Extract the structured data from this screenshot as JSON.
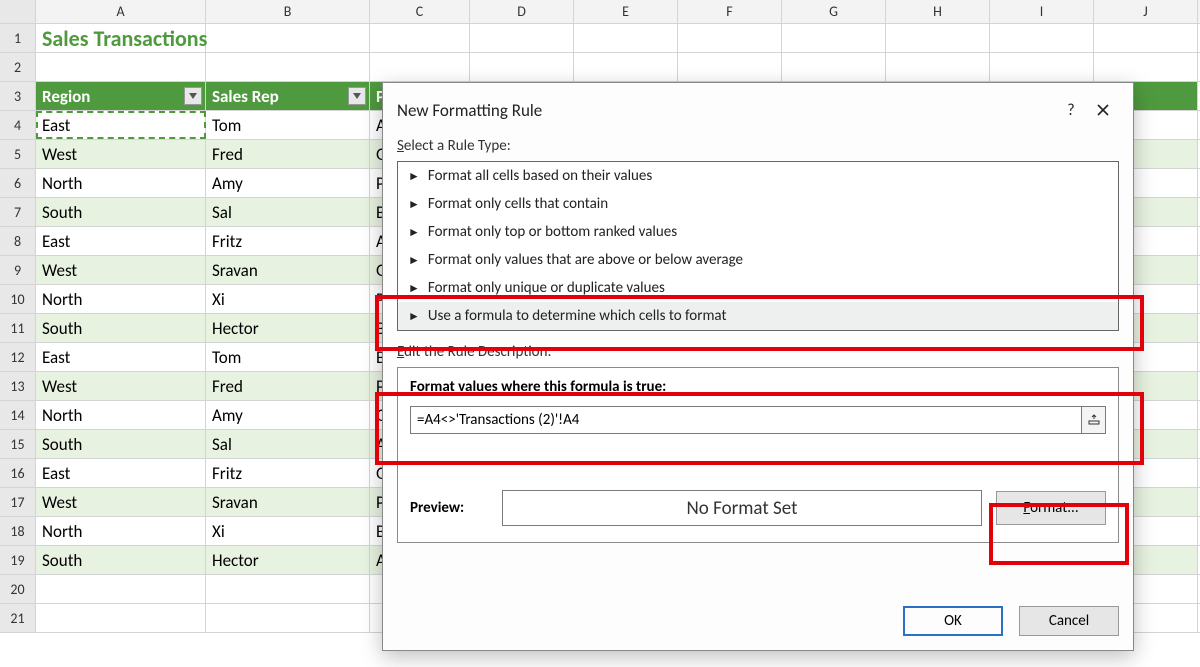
{
  "columns": [
    "A",
    "B",
    "C",
    "D",
    "E",
    "F",
    "G",
    "H",
    "I",
    "J"
  ],
  "title": "Sales Transactions",
  "headers": {
    "a": "Region",
    "b": "Sales Rep",
    "c": "P"
  },
  "rows": [
    {
      "n": 4,
      "a": "East",
      "b": "Tom",
      "c": "A",
      "striped": false,
      "marching": true
    },
    {
      "n": 5,
      "a": "West",
      "b": "Fred",
      "c": "G",
      "striped": true
    },
    {
      "n": 6,
      "a": "North",
      "b": "Amy",
      "c": "P",
      "striped": false
    },
    {
      "n": 7,
      "a": "South",
      "b": "Sal",
      "c": "B",
      "striped": true
    },
    {
      "n": 8,
      "a": "East",
      "b": "Fritz",
      "c": "A",
      "striped": false
    },
    {
      "n": 9,
      "a": "West",
      "b": "Sravan",
      "c": "G",
      "striped": true
    },
    {
      "n": 10,
      "a": "North",
      "b": "Xi",
      "c": "P",
      "striped": false
    },
    {
      "n": 11,
      "a": "South",
      "b": "Hector",
      "c": "B",
      "striped": true
    },
    {
      "n": 12,
      "a": "East",
      "b": "Tom",
      "c": "B",
      "striped": false
    },
    {
      "n": 13,
      "a": "West",
      "b": "Fred",
      "c": "P",
      "striped": true
    },
    {
      "n": 14,
      "a": "North",
      "b": "Amy",
      "c": "G",
      "striped": false
    },
    {
      "n": 15,
      "a": "South",
      "b": "Sal",
      "c": "A",
      "striped": true
    },
    {
      "n": 16,
      "a": "East",
      "b": "Fritz",
      "c": "G",
      "striped": false
    },
    {
      "n": 17,
      "a": "West",
      "b": "Sravan",
      "c": "P",
      "striped": true
    },
    {
      "n": 18,
      "a": "North",
      "b": "Xi",
      "c": "B",
      "striped": false
    },
    {
      "n": 19,
      "a": "South",
      "b": "Hector",
      "c": "A",
      "striped": true
    }
  ],
  "empty_rows": [
    20,
    21
  ],
  "dialog": {
    "title": "New Formatting Rule",
    "help": "?",
    "select_label": "Select a Rule Type:",
    "rule_types": [
      "Format all cells based on their values",
      "Format only cells that contain",
      "Format only top or bottom ranked values",
      "Format only values that are above or below average",
      "Format only unique or duplicate values",
      "Use a formula to determine which cells to format"
    ],
    "edit_label": "Edit the Rule Description:",
    "formula_title": "Format values where this formula is true:",
    "formula_value": "=A4<>'Transactions (2)'!A4",
    "preview_label": "Preview:",
    "preview_text": "No Format Set",
    "format_btn": "Format...",
    "ok": "OK",
    "cancel": "Cancel"
  }
}
